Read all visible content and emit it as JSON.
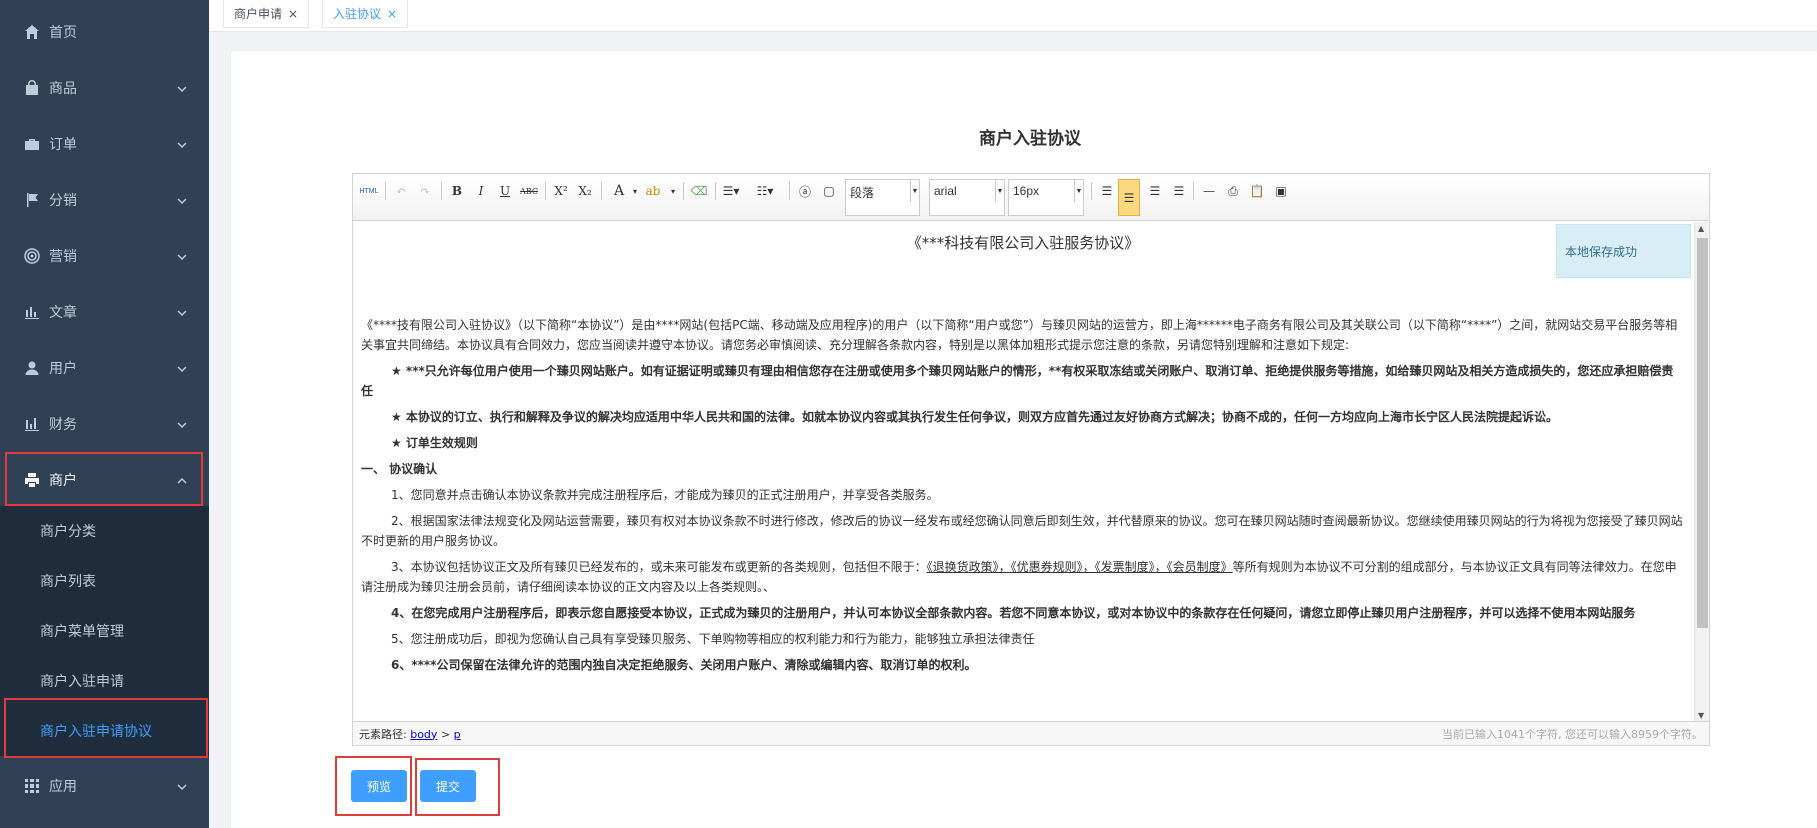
{
  "sidebar": {
    "items": [
      {
        "label": "首页",
        "icon": "home-icon"
      },
      {
        "label": "商品",
        "icon": "bag-icon"
      },
      {
        "label": "订单",
        "icon": "briefcase-icon"
      },
      {
        "label": "分销",
        "icon": "flag-icon"
      },
      {
        "label": "营销",
        "icon": "target-icon"
      },
      {
        "label": "文章",
        "icon": "bar-chart-icon"
      },
      {
        "label": "用户",
        "icon": "user-icon"
      },
      {
        "label": "财务",
        "icon": "finance-chart-icon"
      },
      {
        "label": "商户",
        "icon": "printer-icon"
      },
      {
        "label": "应用",
        "icon": "grid-icon"
      }
    ],
    "submenu": [
      "商户分类",
      "商户列表",
      "商户菜单管理",
      "商户入驻申请",
      "商户入驻申请协议"
    ]
  },
  "tags": [
    {
      "label": "商户申请",
      "close": "×"
    },
    {
      "label": "入驻协议",
      "close": "×"
    }
  ],
  "page_title": "商户入驻协议",
  "editor": {
    "toolbar": {
      "html": "HTML",
      "bold": "B",
      "italic": "I",
      "underline": "U",
      "strike": "ABC",
      "sup": "X²",
      "sub": "X₂",
      "font_color": "A",
      "paragraph": "段落",
      "font_family": "arial",
      "font_size": "16px"
    },
    "save_tip": "本地保存成功",
    "doc_title": "《***科技有限公司入驻服务协议》",
    "paragraphs": [
      "《****技有限公司入驻协议》（以下简称“本协议”）是由****网站(包括PC端、移动端及应用程序)的用户（以下简称“用户或您”）与臻贝网站的运营方，即上海******电子商务有限公司及其关联公司（以下简称“****”）之间，就网站交易平台服务等相关事宜共同缔结。本协议具有合同效力，您应当阅读并遵守本协议。请您务必审慎阅读、充分理解各条款内容，特别是以黑体加粗形式提示您注意的条款，另请您特别理解和注意如下规定:",
      "★ ***只允许每位用户使用一个臻贝网站账户。如有证据证明或臻贝有理由相信您存在注册或使用多个臻贝网站账户的情形，**有权采取冻结或关闭账户、取消订单、拒绝提供服务等措施，如给臻贝网站及相关方造成损失的，您还应承担赔偿责任",
      "★ 本协议的订立、执行和解释及争议的解决均应适用中华人民共和国的法律。如就本协议内容或其执行发生任何争议，则双方应首先通过友好协商方式解决；协商不成的，任何一方均应向上海市长宁区人民法院提起诉讼。",
      "★ 订单生效规则",
      "一、 协议确认",
      "1、您同意并点击确认本协议条款并完成注册程序后，才能成为臻贝的正式注册用户，并享受各类服务。",
      "2、根据国家法律法规变化及网站运营需要，臻贝有权对本协议条款不时进行修改，修改后的协议一经发布或经您确认同意后即刻生效，并代替原来的协议。您可在臻贝网站随时查阅最新协议。您继续使用臻贝网站的行为将视为您接受了臻贝网站不时更新的用户服务协议。",
      "3、本协议包括协议正文及所有臻贝已经发布的，或未来可能发布或更新的各类规则，包括但不限于：",
      "《退换货政策》，《优惠券规则》，《发票制度》，《会员制度》",
      "等所有规则为本协议不可分割的组成部分，与本协议正文具有同等法律效力。在您申请注册成为臻贝注册会员前，请仔细阅读本协议的正文内容及以上各类规则。、",
      "4、在您完成用户注册程序后，即表示您自愿接受本协议，正式成为臻贝的注册用户，并认可本协议全部条款内容。若您不同意本协议，或对本协议中的条款存在任何疑问，请您立即停止臻贝用户注册程序，并可以选择不使用本网站服务",
      "5、您注册成功后，即视为您确认自己具有享受臻贝服务、下单购物等相应的权利能力和行为能力，能够独立承担法律责任",
      "6、****公司保留在法律允许的范围内独自决定拒绝服务、关闭用户账户、清除或编辑内容、取消订单的权利。"
    ],
    "status": {
      "path_label": "元素路径:",
      "path_body": "body",
      "path_sep": ">",
      "path_p": "p",
      "count": "当前已输入1041个字符, 您还可以输入8959个字符。"
    }
  },
  "buttons": {
    "preview": "预览",
    "submit": "提交"
  }
}
